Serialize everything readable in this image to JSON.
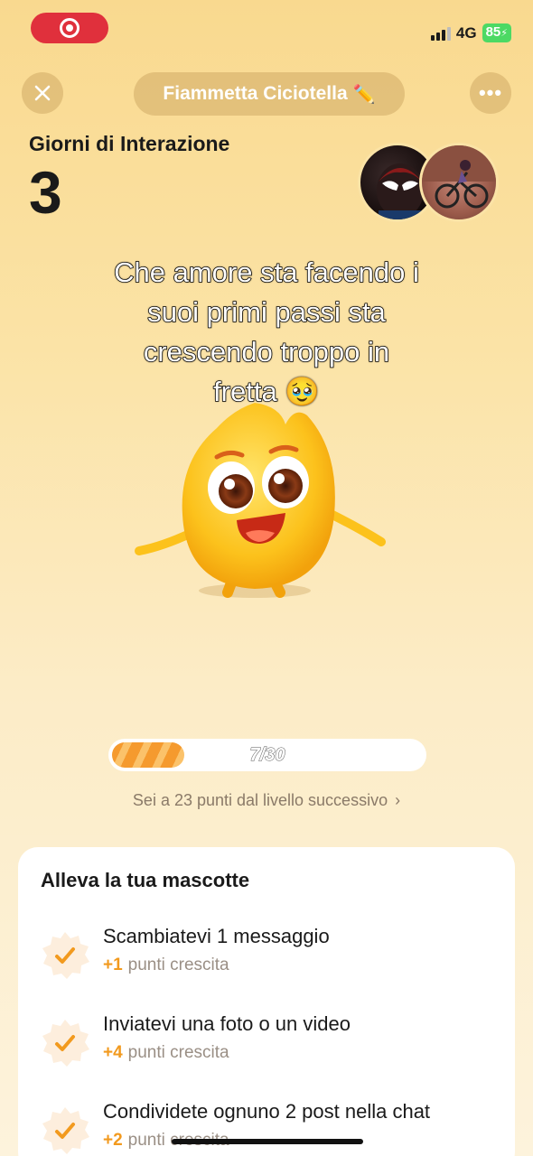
{
  "status_bar": {
    "network": "4G",
    "battery": "85"
  },
  "header": {
    "name": "Fiammetta Ciciotella"
  },
  "interaction": {
    "label": "Giorni di Interazione",
    "days": "3"
  },
  "caption": {
    "line1": "Che amore sta facendo i",
    "line2": "suoi primi passi sta",
    "line3": "crescendo troppo in",
    "line4": "fretta 🥹"
  },
  "progress": {
    "current": 7,
    "max": 30,
    "text": "7/30",
    "next_level_text": "Sei a 23 punti dal livello successivo"
  },
  "card": {
    "title": "Alleva la tua mascotte",
    "tasks": [
      {
        "title": "Scambiatevi 1 messaggio",
        "points": "+1",
        "unit": "punti crescita"
      },
      {
        "title": "Inviatevi una foto o un video",
        "points": "+4",
        "unit": "punti crescita"
      },
      {
        "title": "Condividete ognuno 2 post nella chat",
        "points": "+2",
        "unit": "punti crescita"
      }
    ]
  },
  "colors": {
    "accent": "#f29a1e",
    "record": "#e0303c",
    "battery": "#4cd964"
  }
}
